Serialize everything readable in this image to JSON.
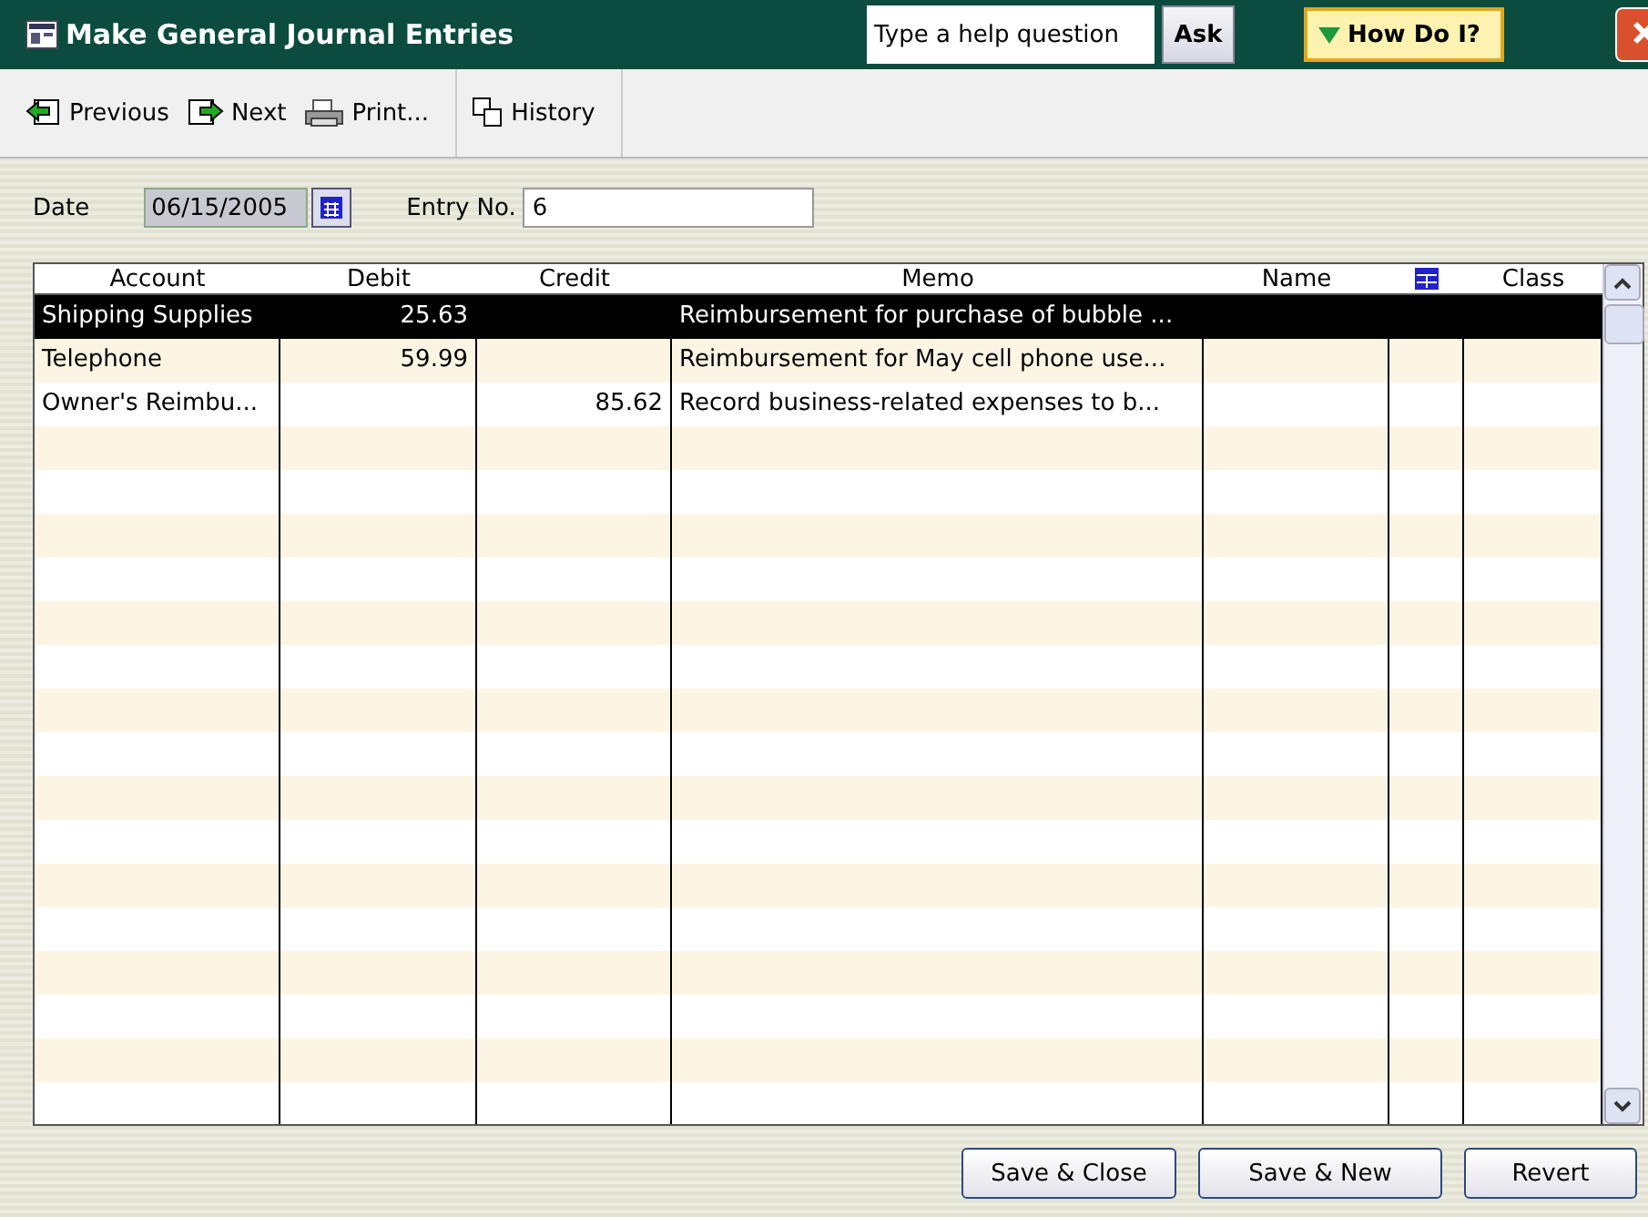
{
  "window": {
    "title": "Make General Journal Entries"
  },
  "help": {
    "placeholder": "Type a help question",
    "ask": "Ask",
    "how_do_i": "How Do I?"
  },
  "toolbar": [
    {
      "kind": "previous",
      "label": "Previous"
    },
    {
      "kind": "next",
      "label": "Next"
    },
    {
      "kind": "print",
      "label": "Print..."
    },
    {
      "kind": "history",
      "label": "History"
    }
  ],
  "form": {
    "date_label": "Date",
    "date": "06/15/2005",
    "entry_label": "Entry No.",
    "entry": "6"
  },
  "table": {
    "columns": [
      "Account",
      "Debit",
      "Credit",
      "Memo",
      "Name",
      "Class"
    ],
    "rows": [
      {
        "account": "Shipping Supplies",
        "debit": "25.63",
        "credit": "",
        "memo": "Reimbursement for purchase of bubble ...",
        "selected": true
      },
      {
        "account": "Telephone",
        "debit": "59.99",
        "credit": "",
        "memo": "Reimbursement for May cell phone use...",
        "selected": false
      },
      {
        "account": "Owner's Reimbu...",
        "debit": "",
        "credit": "85.62",
        "memo": "Record business-related expenses to b...",
        "selected": false
      }
    ]
  },
  "buttons": [
    "Save & Close",
    "Save & New",
    "Revert"
  ]
}
